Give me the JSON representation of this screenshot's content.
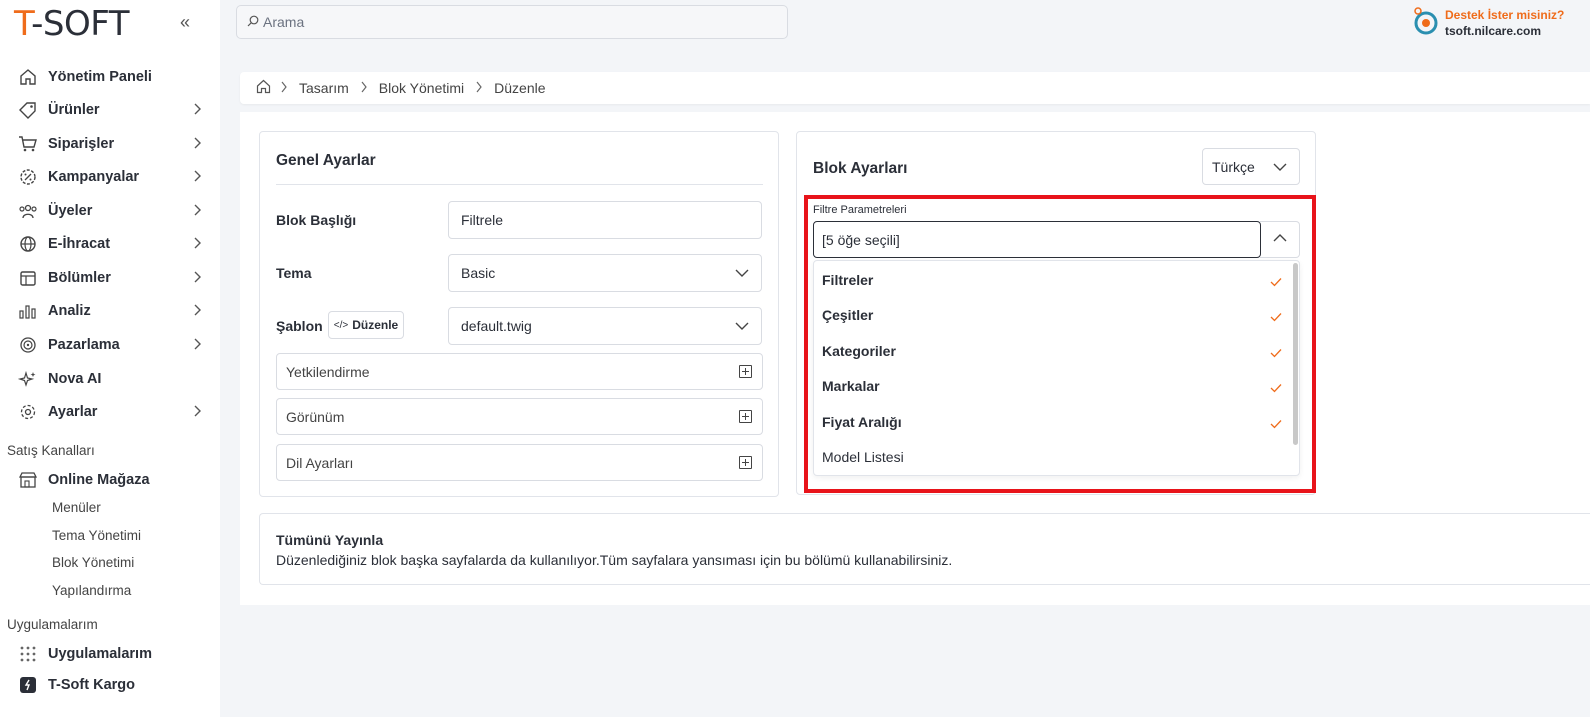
{
  "brand": {
    "logo_t": "T",
    "logo_rest": "-SOFT"
  },
  "search": {
    "placeholder": "Arama"
  },
  "support": {
    "title": "Destek İster misiniz?",
    "subtitle": "tsoft.nilcare.com"
  },
  "sidebar": {
    "items": [
      {
        "label": "Yönetim Paneli",
        "icon": "home-icon"
      },
      {
        "label": "Ürünler",
        "icon": "tag-icon"
      },
      {
        "label": "Siparişler",
        "icon": "cart-icon"
      },
      {
        "label": "Kampanyalar",
        "icon": "discount-icon"
      },
      {
        "label": "Üyeler",
        "icon": "users-icon"
      },
      {
        "label": "E-İhracat",
        "icon": "globe-icon"
      },
      {
        "label": "Bölümler",
        "icon": "sections-icon"
      },
      {
        "label": "Analiz",
        "icon": "analytics-icon"
      },
      {
        "label": "Pazarlama",
        "icon": "target-icon"
      },
      {
        "label": "Nova AI",
        "icon": "sparkle-icon"
      },
      {
        "label": "Ayarlar",
        "icon": "gear-icon"
      }
    ],
    "sales_channels_title": "Satış Kanalları",
    "online_store": "Online Mağaza",
    "sub_items": [
      "Menüler",
      "Tema Yönetimi",
      "Blok Yönetimi",
      "Yapılandırma"
    ],
    "apps_title": "Uygulamalarım",
    "apps_item": "Uygulamalarım",
    "kargo_item": "T-Soft Kargo"
  },
  "breadcrumb": [
    "Tasarım",
    "Blok Yönetimi",
    "Düzenle"
  ],
  "general": {
    "title": "Genel Ayarlar",
    "block_title_label": "Blok Başlığı",
    "block_title_value": "Filtrele",
    "theme_label": "Tema",
    "theme_value": "Basic",
    "template_label": "Şablon",
    "template_edit": "Düzenle",
    "template_value": "default.twig",
    "sections": [
      "Yetkilendirme",
      "Görünüm",
      "Dil Ayarları"
    ]
  },
  "block_settings": {
    "title": "Blok Ayarları",
    "language": "Türkçe",
    "filter_label": "Filtre Parametreleri",
    "selected_summary": "[5 öğe seçili]",
    "options": [
      {
        "label": "Filtreler",
        "selected": true
      },
      {
        "label": "Çeşitler",
        "selected": true
      },
      {
        "label": "Kategoriler",
        "selected": true
      },
      {
        "label": "Markalar",
        "selected": true
      },
      {
        "label": "Fiyat Aralığı",
        "selected": true
      },
      {
        "label": "Model Listesi",
        "selected": false
      }
    ]
  },
  "publish": {
    "title": "Tümünü Yayınla",
    "description": "Düzenlediğiniz blok başka sayfalarda da kullanılıyor.Tüm sayfalara yansıması için bu bölümü kullanabilirsiniz."
  },
  "colors": {
    "accent": "#ef6c1b",
    "highlight": "#e8131a",
    "text": "#2b2f38"
  }
}
